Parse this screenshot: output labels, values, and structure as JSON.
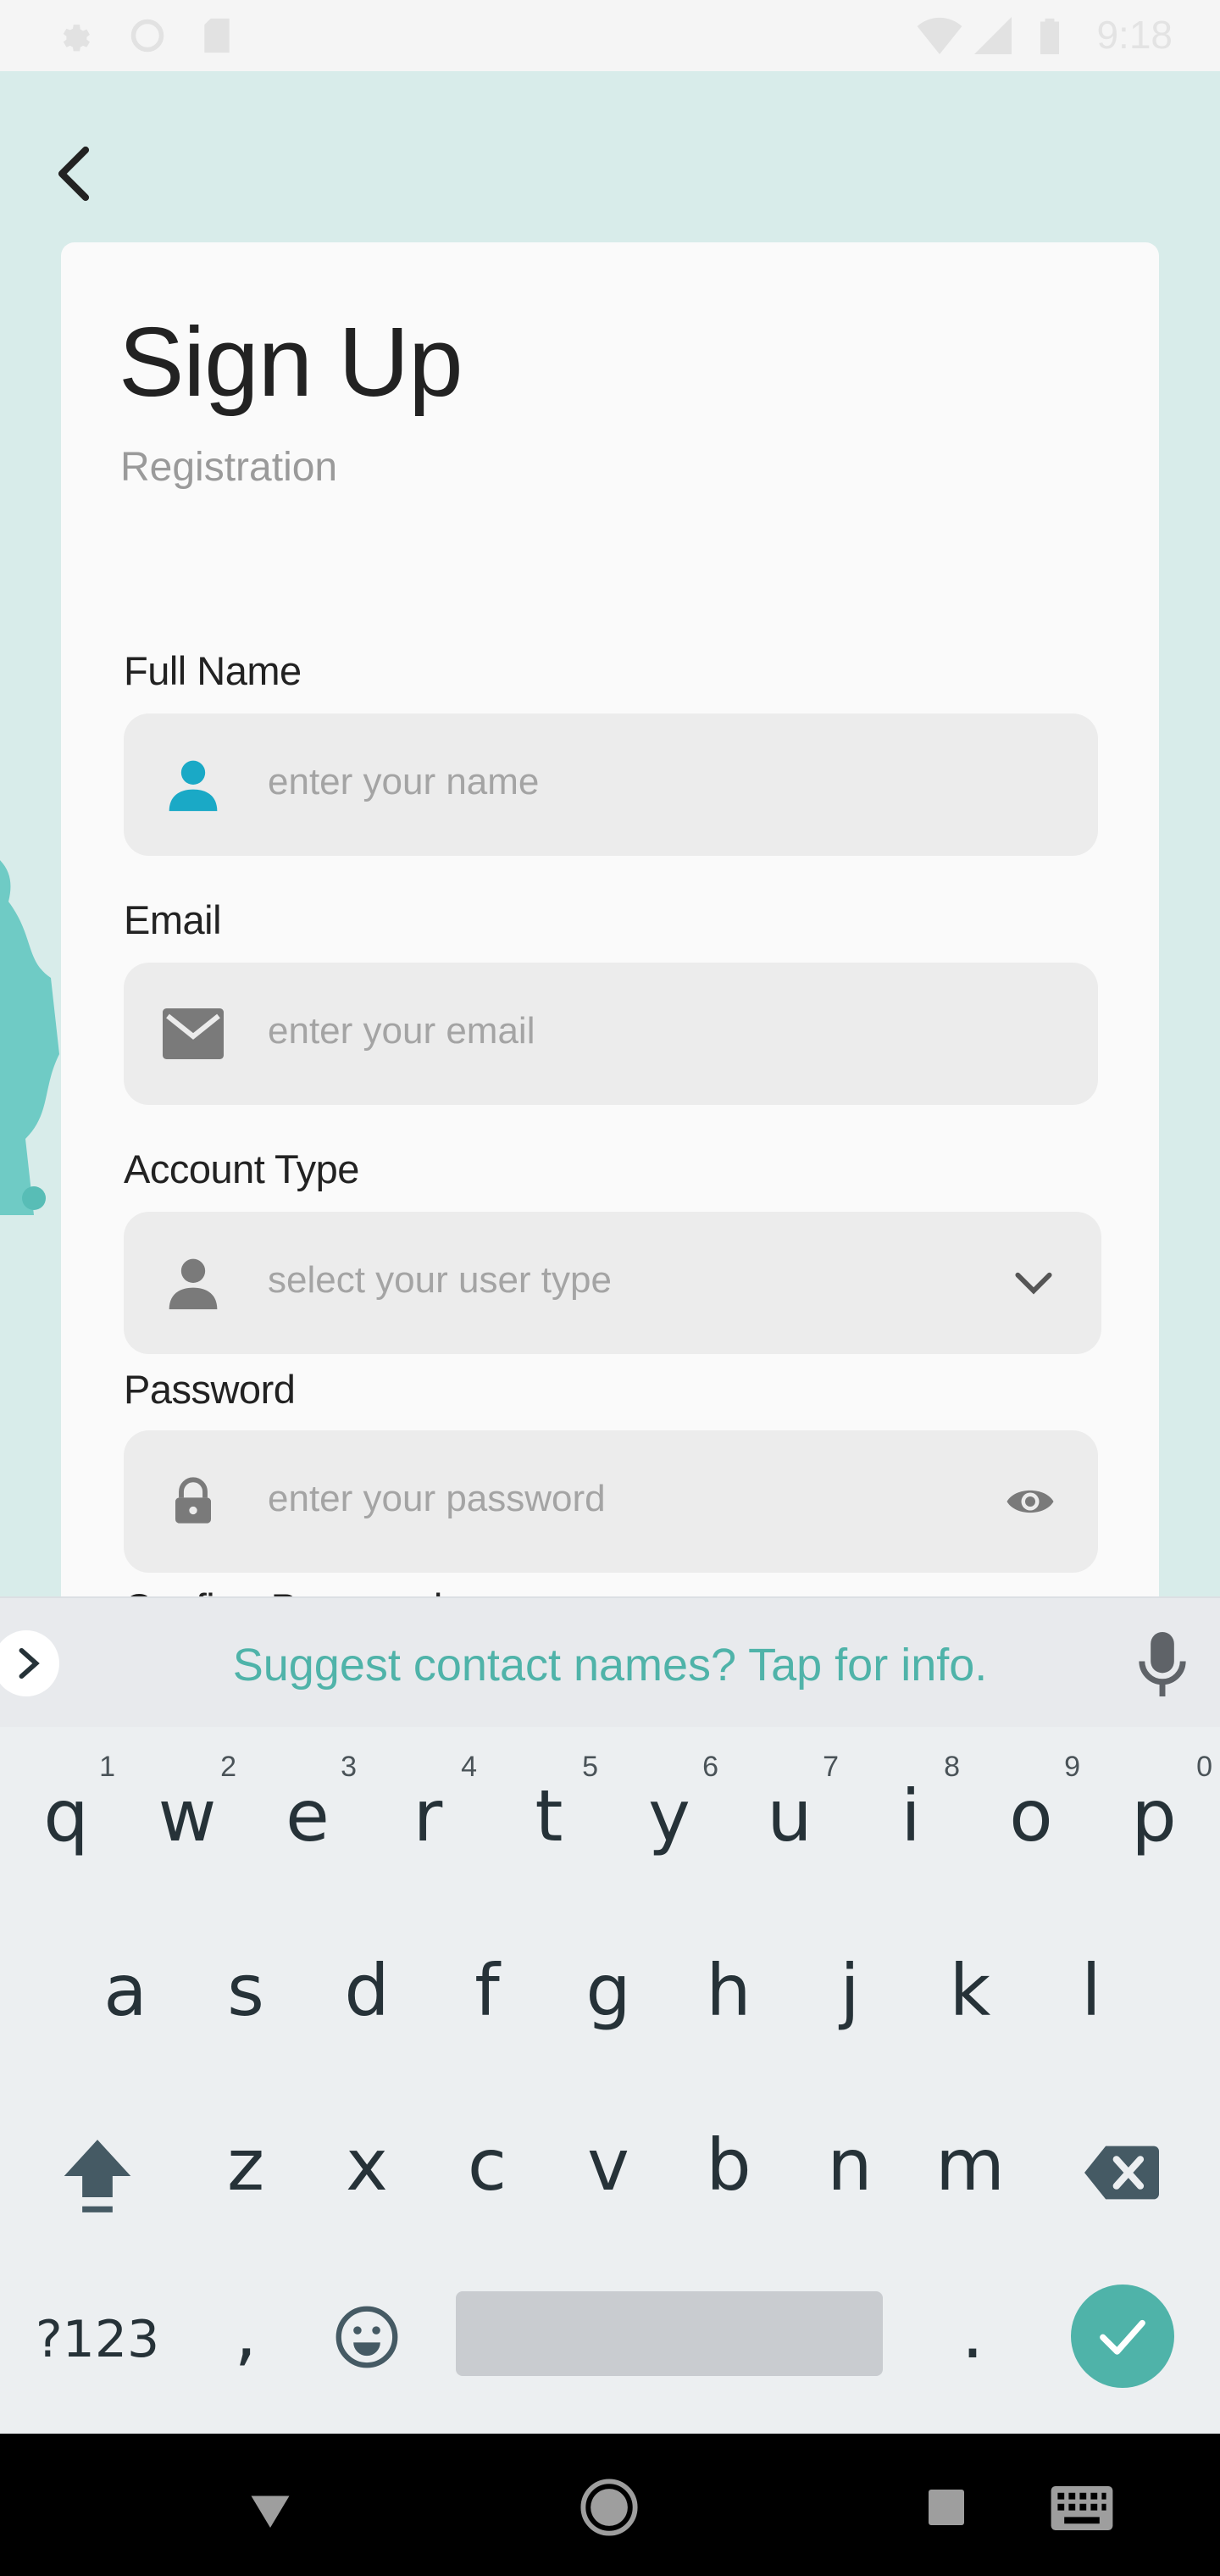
{
  "status_bar": {
    "time": "9:18"
  },
  "header": {
    "back_icon": "chevron-left-icon"
  },
  "form": {
    "title": "Sign Up",
    "subtitle": "Registration",
    "full_name": {
      "label": "Full Name",
      "placeholder": "enter your name",
      "icon": "person-icon"
    },
    "email": {
      "label": "Email",
      "placeholder": "enter your email",
      "icon": "envelope-icon"
    },
    "account_type": {
      "label": "Account Type",
      "placeholder": "select your user type",
      "icon": "person-icon"
    },
    "password": {
      "label": "Password",
      "placeholder": "enter your password",
      "icon": "lock-icon"
    },
    "confirm_password": {
      "label": "Confirm Password"
    }
  },
  "keyboard": {
    "suggestion": "Suggest contact names? Tap for info.",
    "row1": [
      "q",
      "w",
      "e",
      "r",
      "t",
      "y",
      "u",
      "i",
      "o",
      "p"
    ],
    "row1_hints": [
      "1",
      "2",
      "3",
      "4",
      "5",
      "6",
      "7",
      "8",
      "9",
      "0"
    ],
    "row2": [
      "a",
      "s",
      "d",
      "f",
      "g",
      "h",
      "j",
      "k",
      "l"
    ],
    "row3": [
      "z",
      "x",
      "c",
      "v",
      "b",
      "n",
      "m"
    ],
    "symbols_label": "?123",
    "comma": ",",
    "period": "."
  },
  "colors": {
    "accent": "#4fb3a9",
    "person_icon_active": "#1aa9c6",
    "background": "#d8ecea"
  }
}
